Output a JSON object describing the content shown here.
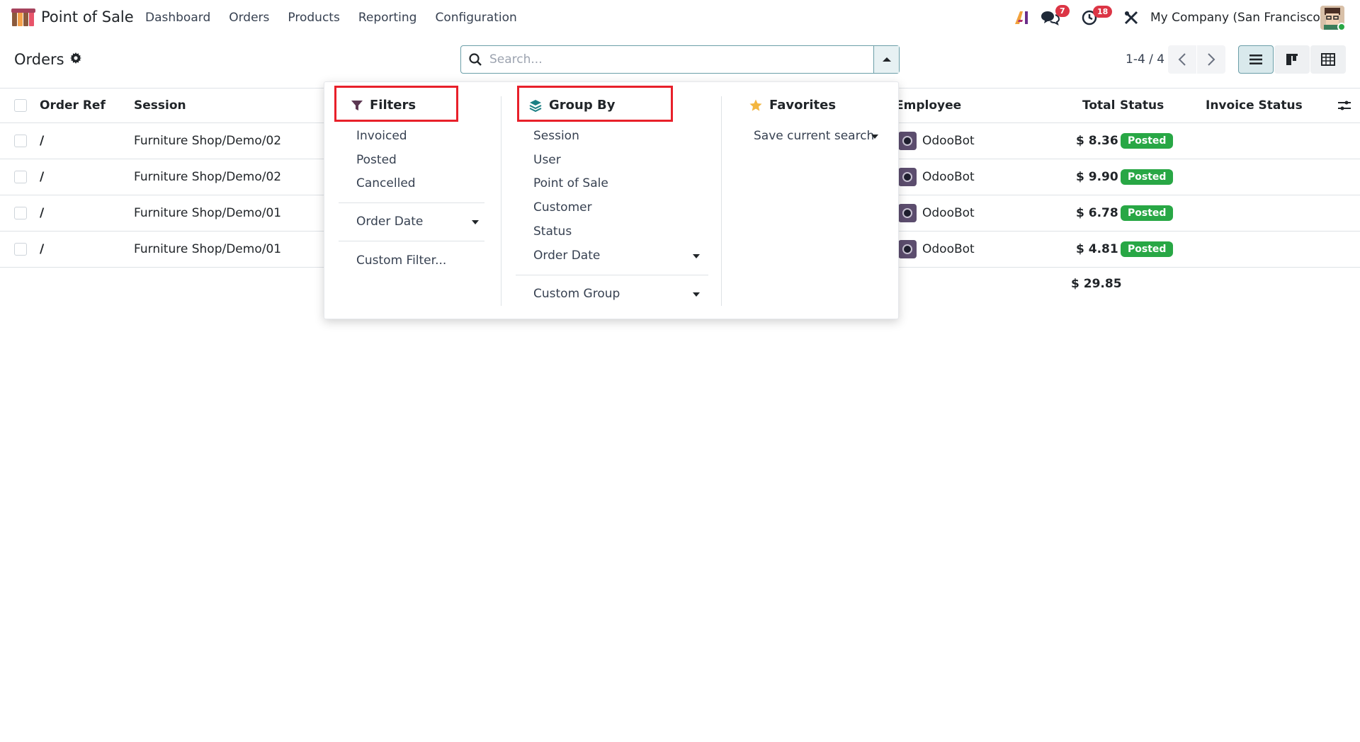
{
  "navbar": {
    "app_name": "Point of Sale",
    "menu": [
      "Dashboard",
      "Orders",
      "Products",
      "Reporting",
      "Configuration"
    ],
    "messages_count": "7",
    "activities_count": "18",
    "company": "My Company (San Francisco)"
  },
  "control_panel": {
    "title": "Orders",
    "search_placeholder": "Search...",
    "pager": "1-4 / 4"
  },
  "table": {
    "columns": [
      "Order Ref",
      "Session",
      "Employee",
      "Total",
      "Status",
      "Invoice Status"
    ],
    "rows": [
      {
        "ref": "/",
        "session": "Furniture Shop/Demo/02",
        "employee": "OdooBot",
        "total": "$ 8.36",
        "status": "Posted"
      },
      {
        "ref": "/",
        "session": "Furniture Shop/Demo/02",
        "employee": "OdooBot",
        "total": "$ 9.90",
        "status": "Posted"
      },
      {
        "ref": "/",
        "session": "Furniture Shop/Demo/01",
        "employee": "OdooBot",
        "total": "$ 6.78",
        "status": "Posted"
      },
      {
        "ref": "/",
        "session": "Furniture Shop/Demo/01",
        "employee": "OdooBot",
        "total": "$ 4.81",
        "status": "Posted"
      }
    ],
    "grand_total": "$ 29.85"
  },
  "dropdown": {
    "filters": {
      "title": "Filters",
      "items": [
        "Invoiced",
        "Posted",
        "Cancelled"
      ],
      "date_item": "Order Date",
      "custom": "Custom Filter..."
    },
    "group_by": {
      "title": "Group By",
      "items": [
        "Session",
        "User",
        "Point of Sale",
        "Customer",
        "Status",
        "Order Date"
      ],
      "custom": "Custom Group"
    },
    "favorites": {
      "title": "Favorites",
      "save": "Save current search"
    }
  },
  "colors": {
    "status_posted": "#28a745",
    "highlight_box": "#e8202a",
    "badge": "#dc3545",
    "accent": "#6b9ea8"
  }
}
